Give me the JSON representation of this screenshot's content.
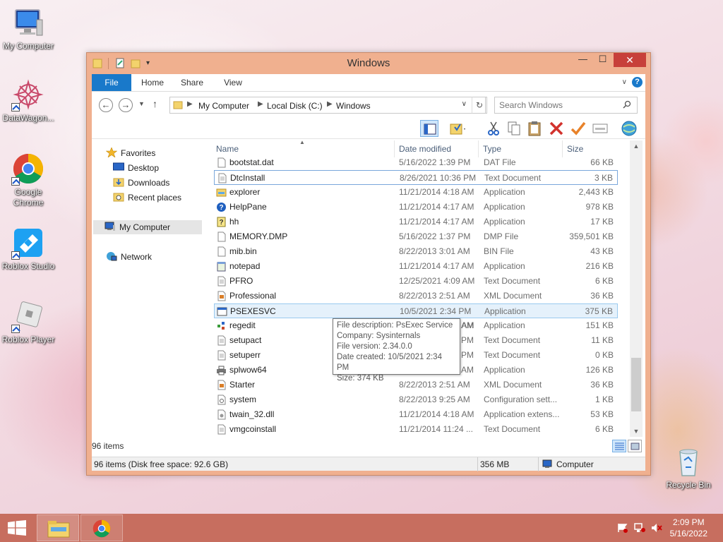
{
  "desktop": {
    "icons": [
      {
        "label": "My Computer",
        "icon": "computer-icon"
      },
      {
        "label": "DataWagon...",
        "icon": "datawagon-icon"
      },
      {
        "label": "Google Chrome",
        "icon": "chrome-icon"
      },
      {
        "label": "Roblox Studio",
        "icon": "roblox-studio-icon"
      },
      {
        "label": "Roblox Player",
        "icon": "roblox-player-icon"
      },
      {
        "label": "Recycle Bin",
        "icon": "recycle-bin-icon"
      }
    ]
  },
  "window": {
    "title": "Windows",
    "close": "✕",
    "minimize": "—",
    "maximize": "☐"
  },
  "ribbon": {
    "tabs": [
      "File",
      "Home",
      "Share",
      "View"
    ],
    "accent": "#1979ca"
  },
  "address": {
    "crumbs": [
      "My Computer",
      "Local Disk (C:)",
      "Windows"
    ],
    "search_placeholder": "Search Windows"
  },
  "nav": {
    "favorites": "Favorites",
    "desktop": "Desktop",
    "downloads": "Downloads",
    "recent": "Recent places",
    "mycomputer": "My Computer",
    "network": "Network"
  },
  "columns": {
    "name": "Name",
    "date": "Date modified",
    "type": "Type",
    "size": "Size"
  },
  "files": [
    {
      "name": "bootstat.dat",
      "date": "5/16/2022 1:39 PM",
      "type": "DAT File",
      "size": "66 KB",
      "icon": "file-icon"
    },
    {
      "name": "DtcInstall",
      "date": "8/26/2021 10:36 PM",
      "type": "Text Document",
      "size": "3 KB",
      "icon": "text-file-icon"
    },
    {
      "name": "explorer",
      "date": "11/21/2014 4:18 AM",
      "type": "Application",
      "size": "2,443 KB",
      "icon": "explorer-icon"
    },
    {
      "name": "HelpPane",
      "date": "11/21/2014 4:17 AM",
      "type": "Application",
      "size": "978 KB",
      "icon": "help-icon"
    },
    {
      "name": "hh",
      "date": "11/21/2014 4:17 AM",
      "type": "Application",
      "size": "17 KB",
      "icon": "help-book-icon"
    },
    {
      "name": "MEMORY.DMP",
      "date": "5/16/2022 1:37 PM",
      "type": "DMP File",
      "size": "359,501 KB",
      "icon": "file-icon"
    },
    {
      "name": "mib.bin",
      "date": "8/22/2013 3:01 AM",
      "type": "BIN File",
      "size": "43 KB",
      "icon": "file-icon"
    },
    {
      "name": "notepad",
      "date": "11/21/2014 4:17 AM",
      "type": "Application",
      "size": "216 KB",
      "icon": "notepad-icon"
    },
    {
      "name": "PFRO",
      "date": "12/25/2021 4:09 AM",
      "type": "Text Document",
      "size": "6 KB",
      "icon": "text-file-icon"
    },
    {
      "name": "Professional",
      "date": "8/22/2013 2:51 AM",
      "type": "XML Document",
      "size": "36 KB",
      "icon": "xml-file-icon"
    },
    {
      "name": "PSEXESVC",
      "date": "10/5/2021 2:34 PM",
      "type": "Application",
      "size": "375 KB",
      "icon": "app-window-icon"
    },
    {
      "name": "regedit",
      "date": "11/21/2014 4:17 AM",
      "type": "Application",
      "size": "151 KB",
      "icon": "regedit-icon"
    },
    {
      "name": "setupact",
      "date": "",
      "type": "Text Document",
      "size": "11 KB",
      "icon": "text-file-icon"
    },
    {
      "name": "setuperr",
      "date": "",
      "type": "Text Document",
      "size": "0 KB",
      "icon": "text-file-icon"
    },
    {
      "name": "splwow64",
      "date": "",
      "type": "Application",
      "size": "126 KB",
      "icon": "printer-icon"
    },
    {
      "name": "Starter",
      "date": "8/22/2013 2:51 AM",
      "type": "XML Document",
      "size": "36 KB",
      "icon": "xml-file-icon"
    },
    {
      "name": "system",
      "date": "8/22/2013 9:25 AM",
      "type": "Configuration sett...",
      "size": "1 KB",
      "icon": "config-file-icon"
    },
    {
      "name": "twain_32.dll",
      "date": "11/21/2014 4:18 AM",
      "type": "Application extens...",
      "size": "53 KB",
      "icon": "dll-file-icon"
    },
    {
      "name": "vmgcoinstall",
      "date": "11/21/2014 11:24 ...",
      "type": "Text Document",
      "size": "6 KB",
      "icon": "text-file-icon"
    }
  ],
  "files_partial_date_suffix": [
    "AM",
    "PM",
    "PM",
    "AM"
  ],
  "tooltip": {
    "line1": "File description: PsExec Service",
    "line2": "Company: Sysinternals",
    "line3": "File version: 2.34.0.0",
    "line4": "Date created: 10/5/2021 2:34 PM",
    "line5": "Size: 374 KB"
  },
  "item_count": "96 items",
  "status": {
    "left": "96 items (Disk free space: 92.6 GB)",
    "mid": "356 MB",
    "right": "Computer"
  },
  "taskbar": {
    "time": "2:09 PM",
    "date": "5/16/2022",
    "color": "#c76e5f"
  }
}
